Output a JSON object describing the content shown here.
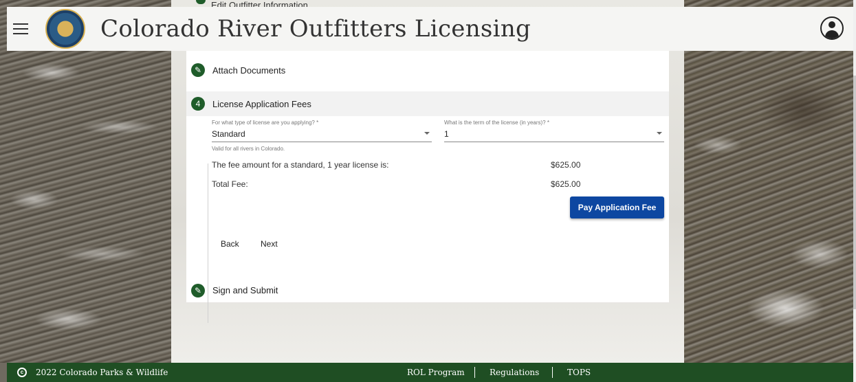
{
  "header": {
    "title": "Colorado River Outfitters Licensing"
  },
  "steps": {
    "hidden_prev": "Edit Outfitter Information",
    "attach": "Attach Documents",
    "fees": {
      "number": "4",
      "label": "License Application Fees"
    },
    "sign": "Sign and Submit"
  },
  "form": {
    "license_type": {
      "label": "For what type of license are you applying? *",
      "value": "Standard",
      "helper": "Valid for all rivers in Colorado."
    },
    "license_term": {
      "label": "What is the term of the license (in years)? *",
      "value": "1"
    },
    "fee_line": {
      "label": "The fee amount for a standard, 1 year license is:",
      "value": "$625.00"
    },
    "total_line": {
      "label": "Total Fee:",
      "value": "$625.00"
    },
    "pay_button": "Pay Application Fee",
    "back_button": "Back",
    "next_button": "Next"
  },
  "footer": {
    "copyright_symbol": "c",
    "copyright": "2022 Colorado Parks & Wildlife",
    "links": [
      "ROL Program",
      "Regulations",
      "TOPS"
    ]
  },
  "colors": {
    "brand_green": "#1f5c2a",
    "footer_green": "#1f4e23",
    "primary_blue": "#0d47a1"
  }
}
